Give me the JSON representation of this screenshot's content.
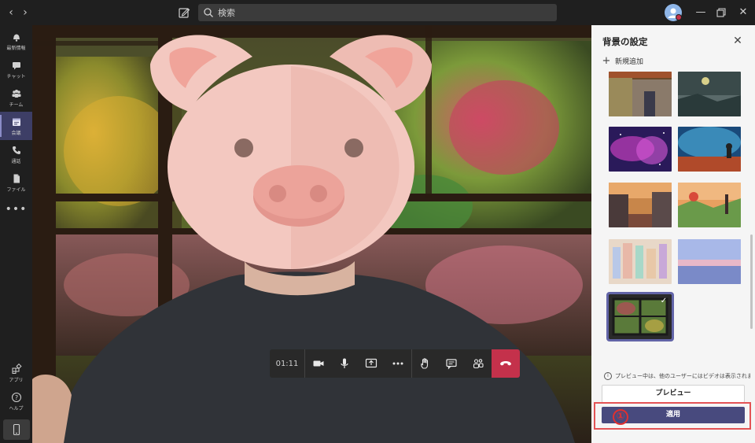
{
  "titlebar": {
    "back_icon": "chevron-left-icon",
    "forward_icon": "chevron-right-icon",
    "compose_icon": "new-chat-icon",
    "search_placeholder": "検索",
    "minimize_icon": "minimize-icon",
    "maximize_icon": "maximize-icon",
    "close_icon": "close-icon"
  },
  "rail": {
    "items": [
      {
        "label": "最新情報",
        "icon": "bell-icon"
      },
      {
        "label": "チャット",
        "icon": "chat-icon"
      },
      {
        "label": "チーム",
        "icon": "teams-icon"
      },
      {
        "label": "会議",
        "icon": "calendar-icon",
        "active": true
      },
      {
        "label": "通話",
        "icon": "phone-icon"
      },
      {
        "label": "ファイル",
        "icon": "file-icon"
      }
    ],
    "more": "•••",
    "bottom_items": [
      {
        "label": "アプリ",
        "icon": "apps-icon"
      },
      {
        "label": "ヘルプ",
        "icon": "help-icon"
      }
    ],
    "device_icon": "mobile-icon"
  },
  "call_controls": {
    "timer": "01:11",
    "buttons": [
      "camera-icon",
      "microphone-icon",
      "share-screen-icon",
      "more-actions-icon",
      "raise-hand-icon",
      "chat-icon",
      "participants-icon"
    ],
    "hangup_icon": "hang-up-icon",
    "hangup_color": "#c4314b"
  },
  "panel": {
    "title": "背景の設定",
    "close_icon": "close-icon",
    "add_new": "新規追加",
    "notice": "プレビュー中は、他のユーザーにはビデオは表示されま...",
    "preview_button": "プレビュー",
    "apply_button": "適用",
    "accent_color": "#6264a7"
  },
  "annotation": {
    "step_marker": "①",
    "highlight_color": "#e35355"
  }
}
